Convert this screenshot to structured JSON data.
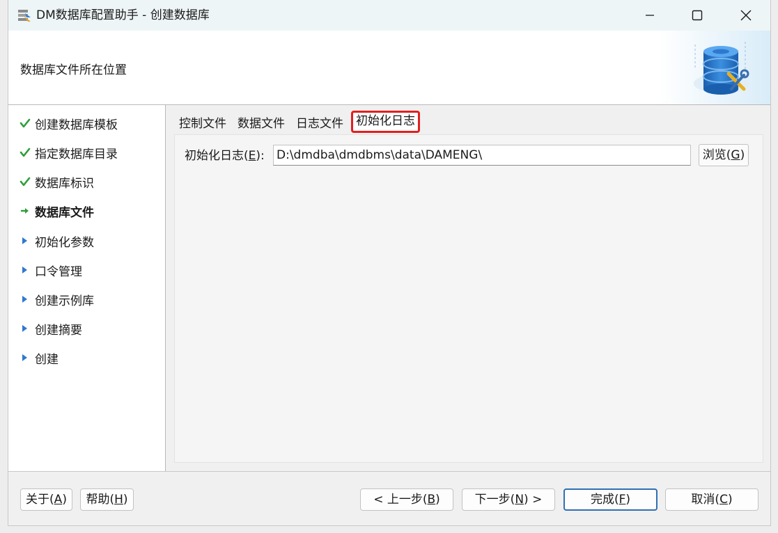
{
  "window": {
    "title": "DM数据库配置助手 - 创建数据库",
    "controls": {
      "minimize": "minimize-icon",
      "maximize": "maximize-icon",
      "close": "close-icon"
    }
  },
  "header": {
    "text": "数据库文件所在位置"
  },
  "sidebar": {
    "items": [
      {
        "label": "创建数据库模板",
        "state": "done"
      },
      {
        "label": "指定数据库目录",
        "state": "done"
      },
      {
        "label": "数据库标识",
        "state": "done"
      },
      {
        "label": "数据库文件",
        "state": "current"
      },
      {
        "label": "初始化参数",
        "state": "pending"
      },
      {
        "label": "口令管理",
        "state": "pending"
      },
      {
        "label": "创建示例库",
        "state": "pending"
      },
      {
        "label": "创建摘要",
        "state": "pending"
      },
      {
        "label": "创建",
        "state": "pending"
      }
    ]
  },
  "tabs": [
    {
      "label": "控制文件"
    },
    {
      "label": "数据文件"
    },
    {
      "label": "日志文件"
    },
    {
      "label": "初始化日志",
      "selected": true
    }
  ],
  "init_log": {
    "label_prefix": "初始化日志(",
    "label_key": "E",
    "label_suffix": "):",
    "value": "D:\\dmdba\\dmdbms\\data\\DAMENG\\",
    "browse_prefix": "浏览(",
    "browse_key": "G",
    "browse_suffix": ")"
  },
  "footer": {
    "about": {
      "prefix": "关于(",
      "key": "A",
      "suffix": ")"
    },
    "help": {
      "prefix": "帮助(",
      "key": "H",
      "suffix": ")"
    },
    "prev": {
      "prefix": "< 上一步(",
      "key": "B",
      "suffix": ")"
    },
    "next": {
      "prefix": "下一步(",
      "key": "N",
      "suffix": ") >"
    },
    "finish": {
      "prefix": "完成(",
      "key": "F",
      "suffix": ")"
    },
    "cancel": {
      "prefix": "取消(",
      "key": "C",
      "suffix": ")"
    }
  },
  "colors": {
    "done_check": "#2e9e3a",
    "current_arrow": "#2e9e3a",
    "pending_triangle": "#2f78d0",
    "highlight_border": "#e21f1f",
    "default_button_border": "#2f6fb5"
  }
}
